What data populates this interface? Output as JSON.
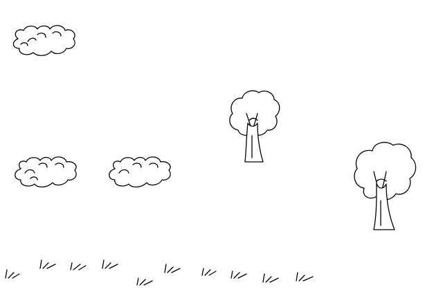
{
  "scene": {
    "background_color": "#ffffff",
    "line_color": "#000000",
    "objects": {
      "clouds": [
        "cloud-icon",
        "cloud-icon",
        "cloud-icon"
      ],
      "trees": [
        "tree-icon",
        "tree-icon"
      ],
      "grass_tufts": [
        "grass-tuft-icon",
        "grass-tuft-icon",
        "grass-tuft-icon",
        "grass-tuft-icon",
        "grass-tuft-icon",
        "grass-tuft-icon",
        "grass-tuft-icon",
        "grass-tuft-icon",
        "grass-tuft-icon",
        "grass-tuft-icon"
      ]
    }
  }
}
